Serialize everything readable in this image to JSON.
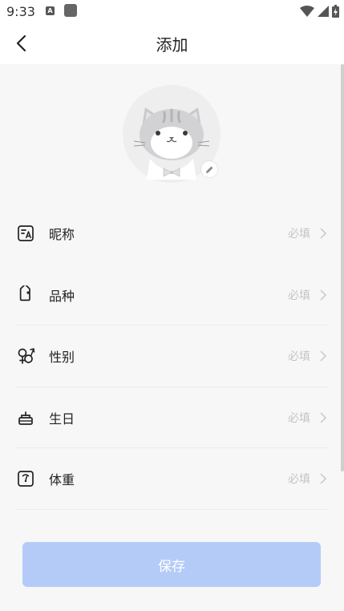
{
  "status_bar": {
    "time": "9:33",
    "notif_a": "A"
  },
  "header": {
    "title": "添加"
  },
  "form": {
    "rows": [
      {
        "label": "昵称",
        "hint": "必填"
      },
      {
        "label": "品种",
        "hint": "必填"
      },
      {
        "label": "性别",
        "hint": "必填"
      },
      {
        "label": "生日",
        "hint": "必填"
      },
      {
        "label": "体重",
        "hint": "必填"
      }
    ]
  },
  "save_button": {
    "label": "保存"
  },
  "colors": {
    "accent_disabled": "#b4cbf8",
    "hint": "#c4c4c6",
    "background": "#f7f7f8"
  },
  "icons": [
    "back-icon",
    "cat-avatar",
    "pencil-icon",
    "nickname-icon",
    "tag-icon",
    "gender-icon",
    "cake-icon",
    "scale-icon",
    "chevron-right-icon"
  ]
}
